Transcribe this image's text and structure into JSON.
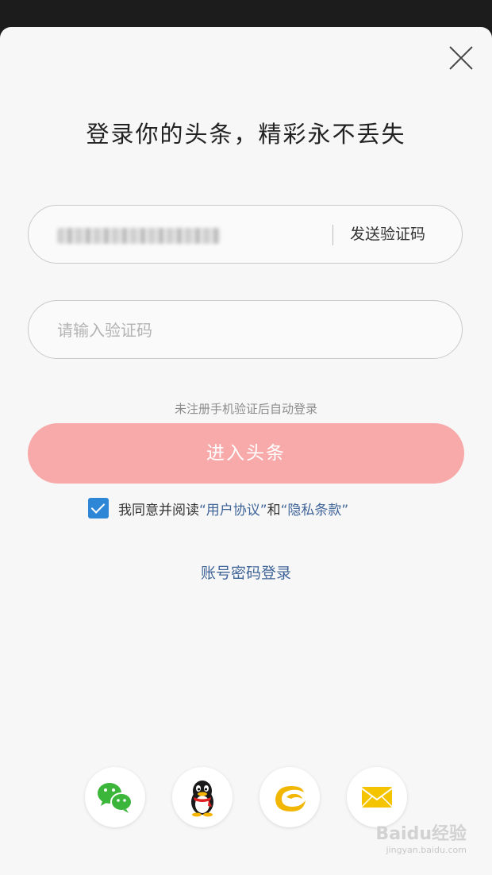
{
  "header": {
    "title": "登录你的头条，精彩永不丢失"
  },
  "form": {
    "phone_value": "",
    "send_code_label": "发送验证码",
    "code_placeholder": "请输入验证码",
    "hint": "未注册手机验证后自动登录",
    "submit_label": "进入头条"
  },
  "agreement": {
    "checked": true,
    "prefix": "我同意并阅读",
    "user_agreement": "“用户协议”",
    "conjunction": "和",
    "privacy_policy": "“隐私条款”"
  },
  "alt_login": {
    "password_login": "账号密码登录"
  },
  "social_logins": [
    {
      "icon": "wechat-icon"
    },
    {
      "icon": "qq-icon"
    },
    {
      "icon": "tianyi-icon"
    },
    {
      "icon": "mail-icon"
    }
  ],
  "watermark": {
    "brand": "Baidu经验",
    "url": "jingyan.baidu.com"
  },
  "colors": {
    "submit_button": "#f7aaa9",
    "link": "#406599",
    "checkbox": "#2e87d6"
  }
}
